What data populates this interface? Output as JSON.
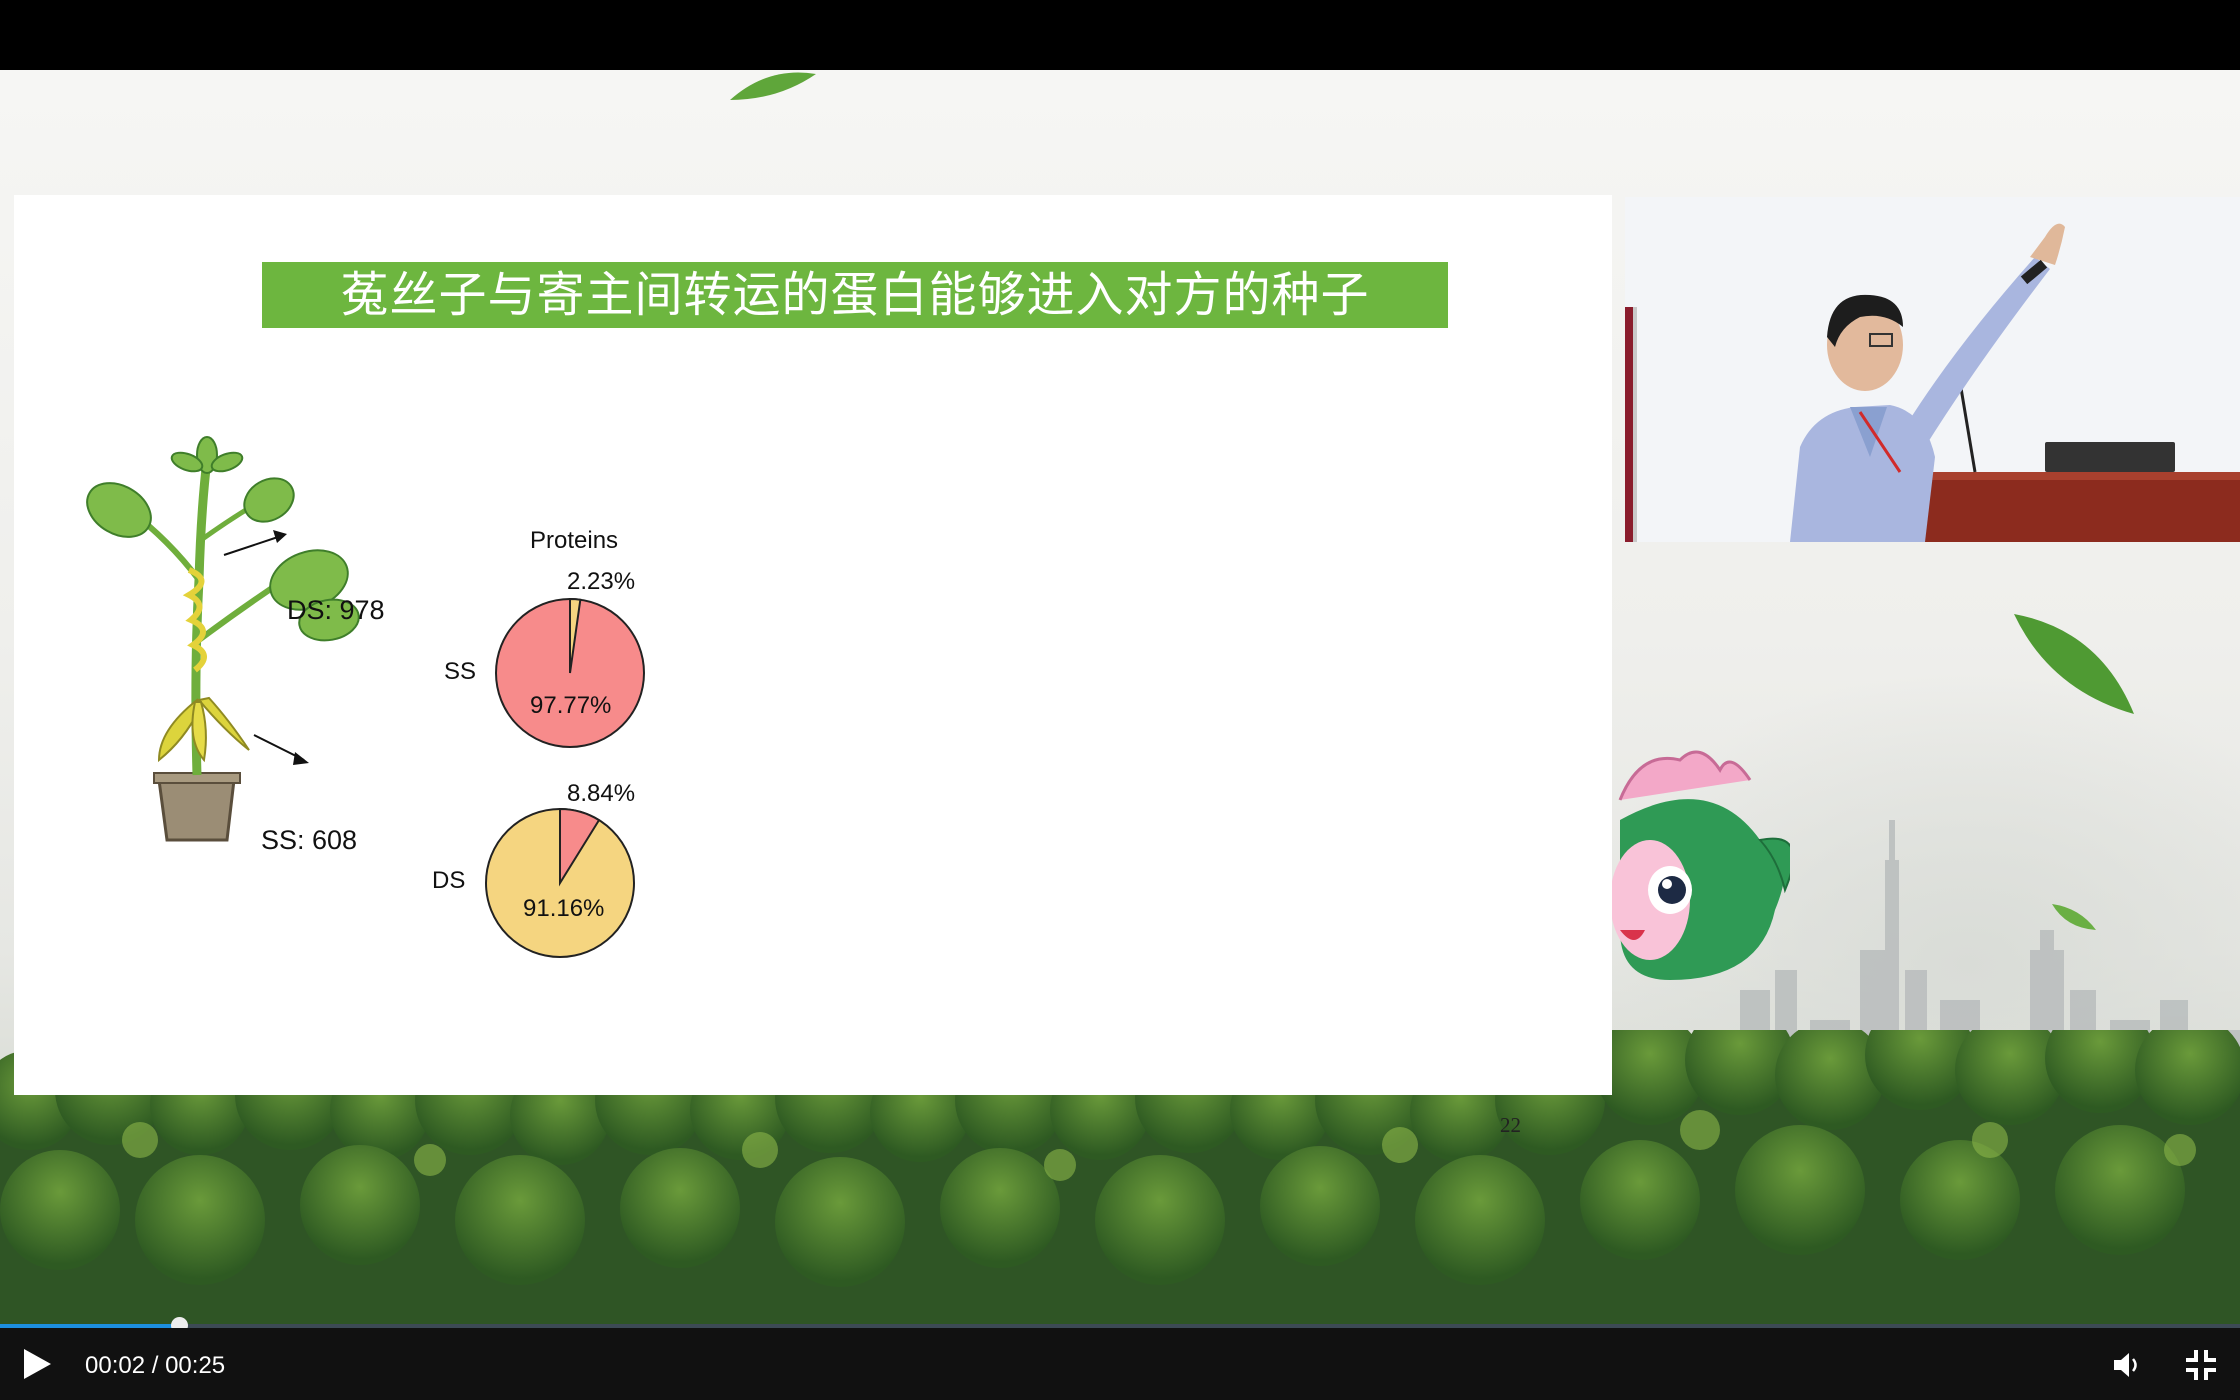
{
  "slide": {
    "title": "菟丝子与寄主间转运的蛋白能够进入对方的种子",
    "page_number": "22",
    "plant_labels": {
      "ds": "DS: 978",
      "ss": "SS: 608"
    },
    "figure_heading": "Proteins",
    "pies": [
      {
        "row_label": "SS",
        "major_pct": "97.77%",
        "minor_pct": "2.23%",
        "major_value": 97.77,
        "minor_value": 2.23,
        "major_color": "#f78b8b",
        "minor_color": "#f5d580"
      },
      {
        "row_label": "DS",
        "major_pct": "91.16%",
        "minor_pct": "8.84%",
        "major_value": 91.16,
        "minor_value": 8.84,
        "major_color": "#f5d580",
        "minor_color": "#f78b8b"
      }
    ]
  },
  "player": {
    "current_time": "00:02",
    "duration": "00:25",
    "progress": 0.08,
    "accent_color": "#1d8fe0",
    "icons": [
      "play-icon",
      "volume-icon",
      "fullscreen-icon"
    ]
  }
}
